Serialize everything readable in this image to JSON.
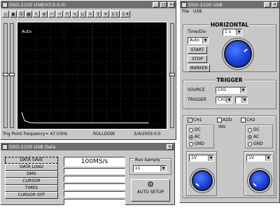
{
  "scope_window": {
    "title": "DSO-2100 USB(V3.0.0.0)",
    "toolbar_icons": [
      "open-icon",
      "save-icon",
      "print-icon",
      "grid-icon",
      "cursor-icon",
      "zoom-icon",
      "rise-icon",
      "fall-icon",
      "pulse-icon",
      "sine-icon",
      "square-icon",
      "probe-icon",
      "measure-icon",
      "cross-icon",
      "close-icon"
    ],
    "toolbar_labels": [
      "1:1",
      "1:4"
    ],
    "screen_label": "Auto",
    "status_trigger": "Trig Point Frequency= 47.03Hz",
    "status_mode": "ROLLDOW",
    "status_date": "3/4/2003:0:0"
  },
  "side_panel": {
    "title": "DSO-2100 USB",
    "menu": [
      "File",
      "USB"
    ],
    "horizontal": {
      "title": "HORIZONTAL",
      "time_div_label": "Time/Div",
      "time_div_value": "1 s",
      "auto_label": "Auto",
      "start_button": "START",
      "stop_button": "STOP",
      "marker_button": "MARKER"
    },
    "trigger": {
      "title": "TRIGGER",
      "source_label": "SOURCE",
      "source_value": "CH1",
      "mode_label": "TRIGGER",
      "mode_value": "CH1"
    },
    "channels": {
      "ch1_label": "CH1",
      "add_label": "ADD",
      "ch2_label": "CH2",
      "inv_label": "INV",
      "ch1_couplings": [
        "DC",
        "AC",
        "GND"
      ],
      "ch2_couplings": [
        "DC",
        "AC",
        "GND"
      ],
      "ch1_volt_value": "1V",
      "ch2_volt_value": "1V"
    }
  },
  "data_window": {
    "title": "DSO-2100 USB Data",
    "menu_items": [
      "DATA SAVE",
      "DATA LOAD",
      "DMS",
      "CURSOR",
      "TIMES",
      "CURSOR OFF"
    ],
    "sample_rate": "100MS/s",
    "run_time_label": "Run Samply",
    "run_time_value": "x1",
    "auto_setup_label": "AUTO SETUP"
  },
  "chart_data": {
    "type": "line",
    "series": [
      {
        "values": [
          0.9,
          0.2,
          0.05,
          0.02,
          0.02,
          0.02,
          0.02,
          0.02,
          0.02,
          0.02,
          0.02,
          0.02
        ]
      }
    ],
    "x": [
      0,
      0.2,
      0.6,
      1,
      2,
      3,
      4,
      5,
      6,
      7,
      8,
      9
    ],
    "xlim": [
      0,
      10
    ],
    "ylim": [
      0,
      8
    ],
    "grid": true
  }
}
